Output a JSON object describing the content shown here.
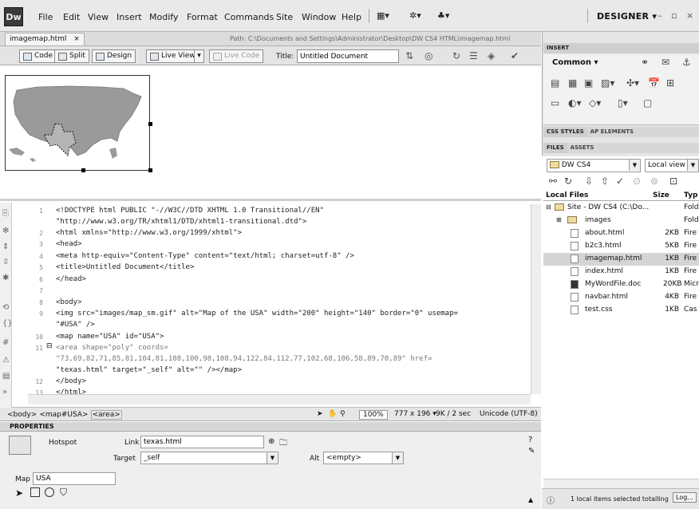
{
  "app": {
    "logo": "Dw",
    "menu": [
      "File",
      "Edit",
      "View",
      "Insert",
      "Modify",
      "Format",
      "Commands",
      "Site",
      "Window",
      "Help"
    ],
    "workspace": "DESIGNER",
    "window_controls": "– ▫ ×"
  },
  "document": {
    "tab": "imagemap.html",
    "path": "Path: C:\\Documents and Settings\\Administrator\\Desktop\\DW CS4 HTML\\imagemap.html",
    "toolbar": {
      "code": "Code",
      "split": "Split",
      "design": "Design",
      "live_view": "Live View",
      "live_code": "Live Code",
      "title_label": "Title:",
      "title_value": "Untitled Document"
    }
  },
  "code": {
    "lines": [
      {
        "num": "1",
        "text": "<!DOCTYPE html PUBLIC \"-//W3C//DTD XHTML 1.0 Transitional//EN\""
      },
      {
        "num": "",
        "text": "\"http://www.w3.org/TR/xhtml1/DTD/xhtml1-transitional.dtd\">"
      },
      {
        "num": "2",
        "text": "<html xmlns=\"http://www.w3.org/1999/xhtml\">"
      },
      {
        "num": "3",
        "text": "<head>"
      },
      {
        "num": "4",
        "text": "<meta http-equiv=\"Content-Type\" content=\"text/html; charset=utf-8\" />"
      },
      {
        "num": "5",
        "text": "<title>Untitled Document</title>"
      },
      {
        "num": "6",
        "text": "</head>"
      },
      {
        "num": "7",
        "text": ""
      },
      {
        "num": "8",
        "text": "<body>"
      },
      {
        "num": "9",
        "text": "<img src=\"images/map_sm.gif\" alt=\"Map of the USA\" width=\"200\" height=\"140\" border=\"0\" usemap="
      },
      {
        "num": "",
        "text": "\"#USA\" />"
      },
      {
        "num": "10",
        "text": "<map name=\"USA\" id=\"USA\">"
      },
      {
        "num": "11",
        "text": "<area shape=\"poly\" coords="
      },
      {
        "num": "",
        "text": "\"73,69,82,71,85,81,104,81,108,100,98,108,94,122,84,112,77,102,68,106,58,89,70,89\" href="
      },
      {
        "num": "",
        "text": "\"texas.html\" target=\"_self\" alt=\"\" /></map>"
      },
      {
        "num": "12",
        "text": "</body>"
      },
      {
        "num": "13",
        "text": "</html>"
      }
    ]
  },
  "status": {
    "tags": [
      "<body>",
      "<map#USA>",
      "<area>"
    ],
    "zoom": "100%",
    "size": "777 x 196",
    "download": "9K / 2 sec",
    "encoding": "Unicode (UTF-8)"
  },
  "properties": {
    "header": "PROPERTIES",
    "hotspot_label": "Hotspot",
    "link_label": "Link",
    "link_value": "texas.html",
    "target_label": "Target",
    "target_value": "_self",
    "alt_label": "Alt",
    "alt_value": "<empty>",
    "map_label": "Map",
    "map_value": "USA"
  },
  "panels": {
    "insert_tab": "INSERT",
    "common": "Common",
    "css_styles": "CSS STYLES",
    "ap_elements": "AP ELEMENTS",
    "files_tab": "FILES",
    "assets_tab": "ASSETS",
    "site_select": "DW CS4",
    "view_select": "Local view",
    "col_local": "Local Files",
    "col_size": "Size",
    "col_type": "Typ",
    "files": [
      {
        "name": "Site - DW CS4 (C:\\Do...",
        "size": "",
        "type": "Fold",
        "kind": "site"
      },
      {
        "name": "images",
        "size": "",
        "type": "Fold",
        "kind": "folder"
      },
      {
        "name": "about.html",
        "size": "2KB",
        "type": "Fire",
        "kind": "file"
      },
      {
        "name": "b2c3.html",
        "size": "5KB",
        "type": "Fire",
        "kind": "file"
      },
      {
        "name": "imagemap.html",
        "size": "1KB",
        "type": "Fire",
        "kind": "file",
        "selected": true
      },
      {
        "name": "index.html",
        "size": "1KB",
        "type": "Fire",
        "kind": "file"
      },
      {
        "name": "MyWordFile.doc",
        "size": "20KB",
        "type": "Micr",
        "kind": "doc"
      },
      {
        "name": "navbar.html",
        "size": "4KB",
        "type": "Fire",
        "kind": "file"
      },
      {
        "name": "test.css",
        "size": "1KB",
        "type": "Cas",
        "kind": "file"
      }
    ],
    "status_text": "1 local items selected totalling",
    "log_button": "Log..."
  }
}
